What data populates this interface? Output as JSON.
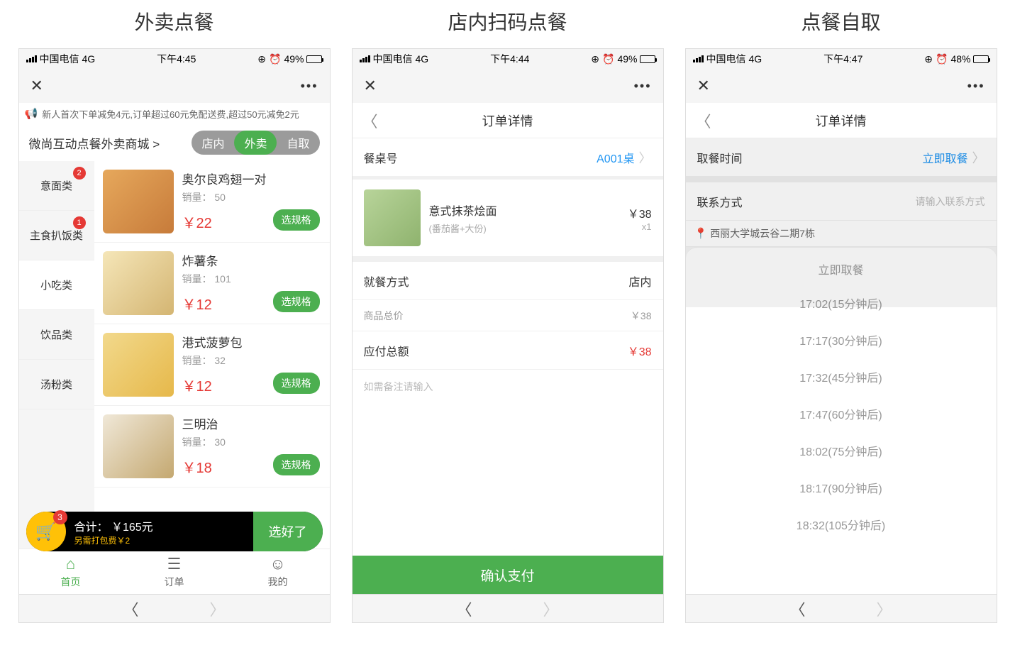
{
  "titles": {
    "p1": "外卖点餐",
    "p2": "店内扫码点餐",
    "p3": "点餐自取"
  },
  "status": {
    "carrier": "中国电信",
    "net": "4G",
    "time1": "下午4:45",
    "bat1": "49%",
    "time2": "下午4:44",
    "bat2": "49%",
    "time3": "下午4:47",
    "bat3": "48%",
    "alarm": "⏰",
    "lock": "⊕"
  },
  "p1": {
    "promo": "新人首次下单减免4元,订单超过60元免配送费,超过50元减免2元",
    "store": "微尚互动点餐外卖商城 >",
    "modes": {
      "a": "店内",
      "b": "外卖",
      "c": "自取"
    },
    "cats": [
      {
        "label": "意面类",
        "badge": "2"
      },
      {
        "label": "主食扒饭类",
        "badge": "1"
      },
      {
        "label": "小吃类"
      },
      {
        "label": "饮品类"
      },
      {
        "label": "汤粉类"
      }
    ],
    "foods": [
      {
        "name": "奥尔良鸡翅一对",
        "sales": "销量： 50",
        "price": "￥22",
        "btn": "选规格"
      },
      {
        "name": "炸薯条",
        "sales": "销量： 101",
        "price": "￥12",
        "btn": "选规格"
      },
      {
        "name": "港式菠萝包",
        "sales": "销量： 32",
        "price": "￥12",
        "btn": "选规格"
      },
      {
        "name": "三明治",
        "sales": "销量： 30",
        "price": "￥18",
        "btn": "选规格"
      }
    ],
    "cart": {
      "badge": "3",
      "total": "合计： ￥165元",
      "fee": "另需打包费￥2",
      "btn": "选好了"
    },
    "tabs": {
      "home": "首页",
      "order": "订单",
      "mine": "我的"
    }
  },
  "p2": {
    "title": "订单详情",
    "table_label": "餐桌号",
    "table_val": "A001桌",
    "item": {
      "name": "意式抹茶烩面",
      "spec": "(番茄酱+大份)",
      "price": "￥38",
      "qty": "x1"
    },
    "dine_label": "就餐方式",
    "dine_val": "店内",
    "subtotal_label": "商品总价",
    "subtotal_val": "￥38",
    "total_label": "应付总额",
    "total_val": "￥38",
    "remark_ph": "如需备注请输入",
    "confirm": "确认支付"
  },
  "p3": {
    "title": "订单详情",
    "pickup_label": "取餐时间",
    "pickup_val": "立即取餐",
    "contact_label": "联系方式",
    "contact_ph": "请输入联系方式",
    "addr": "西丽大学城云谷二期7栋",
    "picker_title": "立即取餐",
    "opts": [
      "17:02(15分钟后)",
      "17:17(30分钟后)",
      "17:32(45分钟后)",
      "17:47(60分钟后)",
      "18:02(75分钟后)",
      "18:17(90分钟后)",
      "18:32(105分钟后)"
    ]
  }
}
